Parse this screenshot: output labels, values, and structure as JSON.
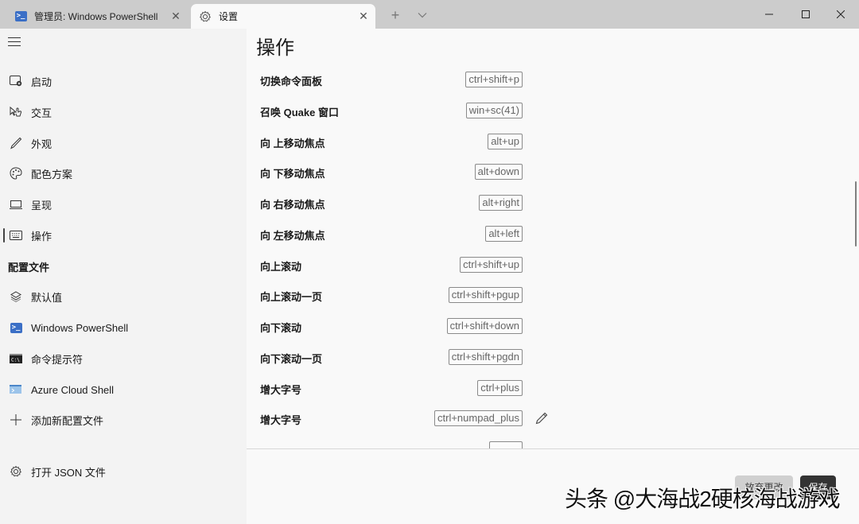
{
  "titlebar": {
    "tabs": [
      {
        "label": "管理员: Windows PowerShell",
        "icon": "powershell-icon",
        "active": false
      },
      {
        "label": "设置",
        "icon": "gear-icon",
        "active": true
      }
    ],
    "new_tab": "+",
    "dropdown": "⌄",
    "window_controls": {
      "minimize": "—",
      "maximize": "☐",
      "close": "✕"
    }
  },
  "sidebar": {
    "items": [
      {
        "label": "启动",
        "icon": "startup-icon"
      },
      {
        "label": "交互",
        "icon": "interaction-icon"
      },
      {
        "label": "外观",
        "icon": "pen-icon"
      },
      {
        "label": "配色方案",
        "icon": "palette-icon"
      },
      {
        "label": "呈现",
        "icon": "monitor-icon"
      },
      {
        "label": "操作",
        "icon": "keyboard-icon",
        "selected": true
      }
    ],
    "profiles_header": "配置文件",
    "profiles": [
      {
        "label": "默认值",
        "icon": "layers-icon"
      },
      {
        "label": "Windows PowerShell",
        "icon": "powershell-icon"
      },
      {
        "label": "命令提示符",
        "icon": "cmd-icon"
      },
      {
        "label": "Azure Cloud Shell",
        "icon": "azure-icon"
      },
      {
        "label": "添加新配置文件",
        "icon": "plus-icon"
      }
    ],
    "open_json": {
      "label": "打开 JSON 文件",
      "icon": "gear-icon"
    }
  },
  "main": {
    "title": "操作",
    "actions": [
      {
        "label": "切换命令面板",
        "keys": "ctrl+shift+p"
      },
      {
        "label": "召唤 Quake 窗口",
        "keys": "win+sc(41)"
      },
      {
        "label": "向 上移动焦点",
        "keys": "alt+up"
      },
      {
        "label": "向 下移动焦点",
        "keys": "alt+down"
      },
      {
        "label": "向 右移动焦点",
        "keys": "alt+right"
      },
      {
        "label": "向 左移动焦点",
        "keys": "alt+left"
      },
      {
        "label": "向上滚动",
        "keys": "ctrl+shift+up"
      },
      {
        "label": "向上滚动一页",
        "keys": "ctrl+shift+pgup"
      },
      {
        "label": "向下滚动",
        "keys": "ctrl+shift+down"
      },
      {
        "label": "向下滚动一页",
        "keys": "ctrl+shift+pgdn"
      },
      {
        "label": "增大字号",
        "keys": "ctrl+plus"
      },
      {
        "label": "增大字号",
        "keys": "ctrl+numpad_plus",
        "hover_edit": true
      }
    ],
    "footer": {
      "discard_label": "放弃更改",
      "save_label": "保存"
    }
  },
  "watermark": "头条 @大海战2硬核海战游戏",
  "colors": {
    "titlebar_bg": "#cccccc",
    "sidebar_bg": "#f3f3f3",
    "content_bg": "#f9f9f9",
    "save_button_bg": "#333333",
    "discard_button_bg": "#d0d0d0",
    "powershell_blue": "#3b6fc6"
  }
}
